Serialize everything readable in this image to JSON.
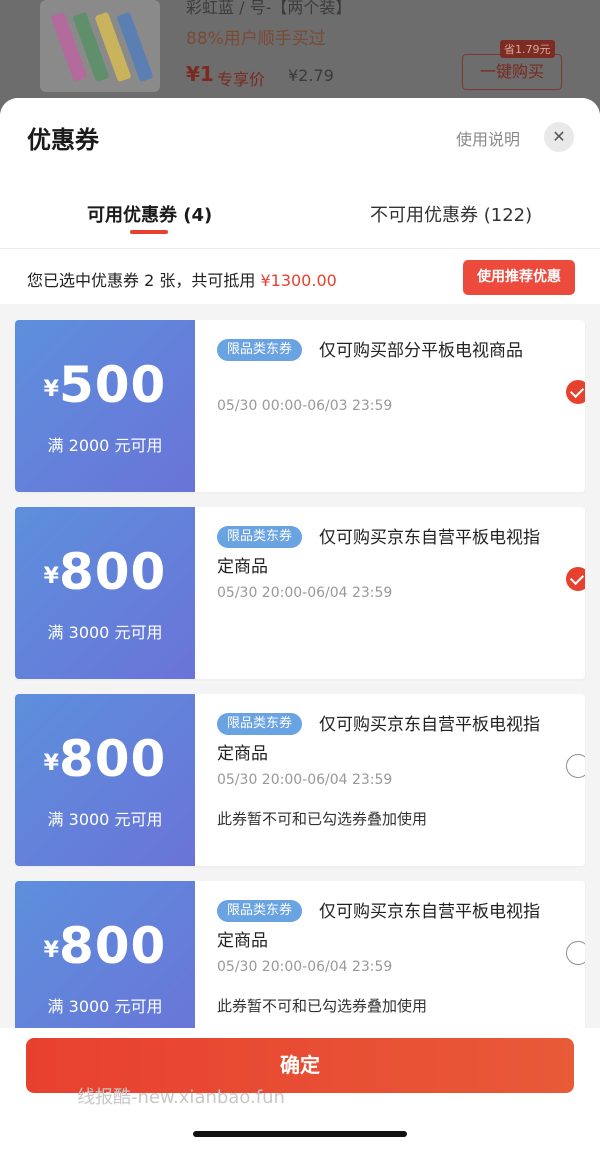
{
  "background_product": {
    "line1": "彩虹蓝 / 号-【两个装】",
    "line2": "88%用户顺手买过",
    "price_symbol": "¥1",
    "price_label": "专享价",
    "original_price": "¥2.79",
    "save_badge": "省1.79元",
    "buy_button": "一键购买"
  },
  "sheet": {
    "title": "优惠券",
    "usage_link": "使用说明",
    "close_icon": "close-icon",
    "tabs": [
      {
        "label": "可用优惠券 (4)",
        "active": true
      },
      {
        "label": "不可用优惠券 (122)",
        "active": false
      }
    ],
    "summary": {
      "prefix": "您已选中优惠券 2 张，共可抵用 ",
      "amount": "¥1300.00",
      "button": "使用推荐优惠"
    },
    "coupons": [
      {
        "yen": "¥",
        "amount": "500",
        "condition": "满 2000 元可用",
        "tag": "限品类东券",
        "desc": "仅可购买部分平板电视商品",
        "valid": "05/30 00:00-06/03 23:59",
        "note": "",
        "selected": true
      },
      {
        "yen": "¥",
        "amount": "800",
        "condition": "满 3000 元可用",
        "tag": "限品类东券",
        "desc": "仅可购买京东自营平板电视指定商品",
        "valid": "05/30 20:00-06/04 23:59",
        "note": "",
        "selected": true
      },
      {
        "yen": "¥",
        "amount": "800",
        "condition": "满 3000 元可用",
        "tag": "限品类东券",
        "desc": "仅可购买京东自营平板电视指定商品",
        "valid": "05/30 20:00-06/04 23:59",
        "note": "此券暂不可和已勾选券叠加使用",
        "selected": false
      },
      {
        "yen": "¥",
        "amount": "800",
        "condition": "满 3000 元可用",
        "tag": "限品类东券",
        "desc": "仅可购买京东自营平板电视指定商品",
        "valid": "05/30 20:00-06/04 23:59",
        "note": "此券暂不可和已勾选券叠加使用",
        "selected": false
      }
    ],
    "confirm_button": "确定",
    "watermark": "线报酷-new.xianbao.fun"
  },
  "colors": {
    "accent": "#e8402f",
    "coupon_gradient_start": "#5d8fdc",
    "coupon_gradient_end": "#6a74d8",
    "tag": "#6aa3e2"
  }
}
